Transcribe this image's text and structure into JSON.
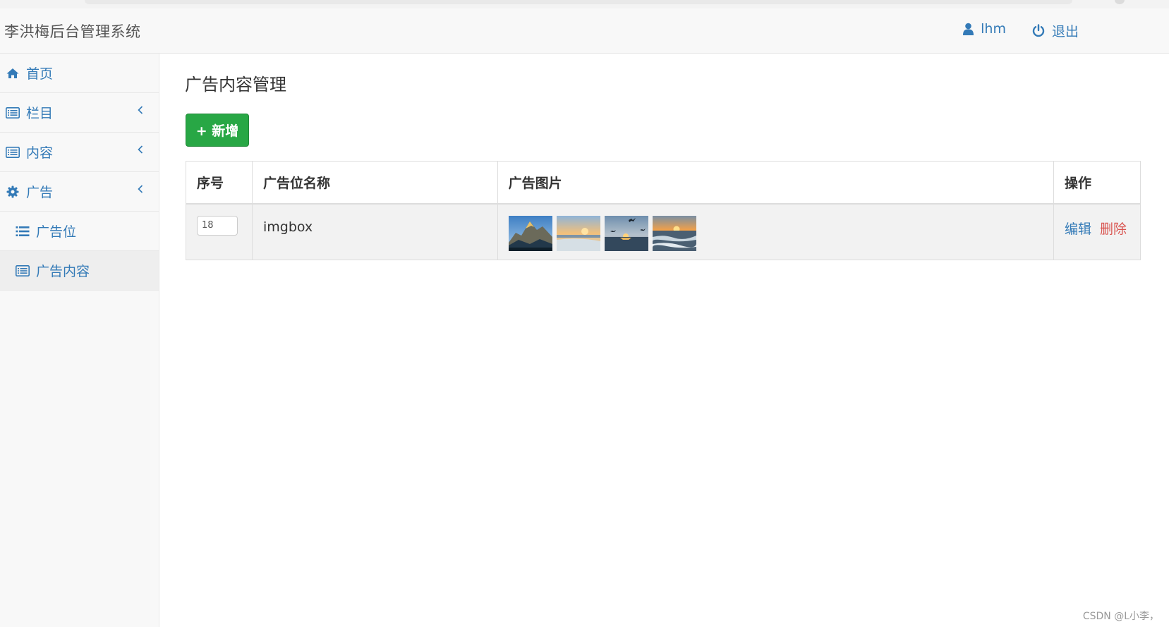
{
  "app": {
    "title": "李洪梅后台管理系统"
  },
  "navbar": {
    "user": {
      "label": "lhm",
      "icon": "user-icon"
    },
    "logout": {
      "label": "退出",
      "icon": "power-icon"
    }
  },
  "sidebar": {
    "items": [
      {
        "label": "首页",
        "icon": "home-icon"
      },
      {
        "label": "栏目",
        "icon": "list-alt-icon",
        "has_chevron": true
      },
      {
        "label": "内容",
        "icon": "list-alt-icon",
        "has_chevron": true
      },
      {
        "label": "广告",
        "icon": "gear-icon",
        "has_chevron": true
      },
      {
        "label": "广告位",
        "icon": "list-icon",
        "sub": true
      },
      {
        "label": "广告内容",
        "icon": "list-alt-icon",
        "sub": true,
        "active": true
      }
    ]
  },
  "main": {
    "title": "广告内容管理",
    "add_button": "+ 新增",
    "table": {
      "headers": [
        "序号",
        "广告位名称",
        "广告图片",
        "操作"
      ],
      "rows": [
        {
          "order": "18",
          "name": "imgbox",
          "images": [
            "mountain-thumb",
            "sunset-beach-thumb",
            "sunset-birds-thumb",
            "sunset-waves-thumb"
          ],
          "edit": "编辑",
          "delete": "删除"
        }
      ]
    }
  },
  "colors": {
    "accent": "#337ab7",
    "success": "#28a745",
    "danger": "#d9534f"
  },
  "watermark": "CSDN @L小李，"
}
